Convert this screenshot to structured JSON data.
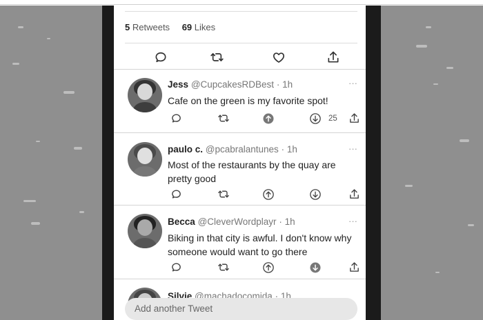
{
  "stats": {
    "retweets_count": "5",
    "retweets_label": "Retweets",
    "likes_count": "69",
    "likes_label": "Likes"
  },
  "main_actions": [
    {
      "name": "reply-icon"
    },
    {
      "name": "retweet-icon"
    },
    {
      "name": "heart-icon"
    },
    {
      "name": "share-icon"
    }
  ],
  "tweets": [
    {
      "display_name": "Jess",
      "handle": "@CupcakesRDBest",
      "time": "· 1h",
      "text": "Cafe on the green is my favorite spot!",
      "vote_count": "25"
    },
    {
      "display_name": "paulo c.",
      "handle": "@pcabralantunes",
      "time": "· 1h",
      "text": "Most of the restaurants by the quay are pretty good"
    },
    {
      "display_name": "Becca",
      "handle": "@CleverWordplayr",
      "time": "· 1h",
      "text": "Biking in that city is awful. I don't know why someone would want to go there"
    },
    {
      "display_name": "Silvie",
      "handle": "@machadocomida",
      "time": "· 1h"
    }
  ],
  "more_label": "···",
  "composer": {
    "placeholder": "Add another Tweet"
  }
}
